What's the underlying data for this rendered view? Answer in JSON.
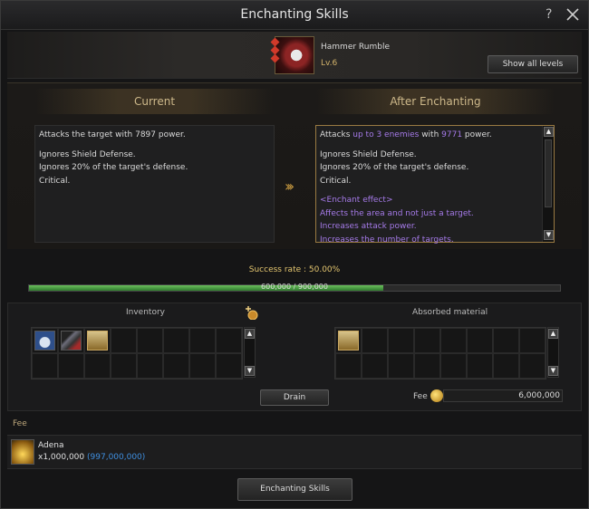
{
  "window": {
    "title": "Enchanting Skills",
    "help": "?",
    "close": "✕"
  },
  "skill": {
    "name": "Hammer Rumble",
    "level": "Lv.6",
    "show_all": "Show all levels"
  },
  "compare": {
    "current_header": "Current",
    "after_header": "After Enchanting",
    "current": {
      "line1": "Attacks the target with 7897 power.",
      "line2": "Ignores Shield Defense.",
      "line3": "Ignores 20% of the target's defense.",
      "line4": "Critical."
    },
    "after": {
      "attacks_prefix": "Attacks ",
      "attacks_hl1": "up to 3 enemies",
      "attacks_mid": " with ",
      "attacks_hl2": "9771",
      "attacks_suffix": " power.",
      "line2": "Ignores Shield Defense.",
      "line3": "Ignores 20% of the target's defense.",
      "line4": "Critical.",
      "effect_title": "<Enchant effect>",
      "effect1": "Affects the area and not just a target.",
      "effect2": "Increases attack power.",
      "effect3": "Increases the number of targets."
    },
    "arrows": "›››"
  },
  "success": {
    "rate_text": "Success rate : 50.00%",
    "progress_text": "600,000 / 900,000",
    "progress_fraction": 0.6667
  },
  "inventory": {
    "label": "Inventory",
    "items": [
      "bag",
      "scroll",
      "chest"
    ],
    "item_icons": [
      "bag-icon",
      "scroll-icon",
      "chest-icon"
    ]
  },
  "absorbed": {
    "label": "Absorbed material",
    "items": [
      "chest"
    ]
  },
  "drain_label": "Drain",
  "fee": {
    "label": "Fee",
    "value": "6,000,000",
    "section_label": "Fee",
    "currency_name": "Adena",
    "currency_qty": "x1,000,000",
    "currency_owned": "(997,000,000)"
  },
  "enchant_button": "Enchanting Skills",
  "colors": {
    "highlight_purple": "#a57ae8",
    "gold": "#e3c56f",
    "progress_green": "#4fa042",
    "owned_blue": "#3f8fe0"
  }
}
